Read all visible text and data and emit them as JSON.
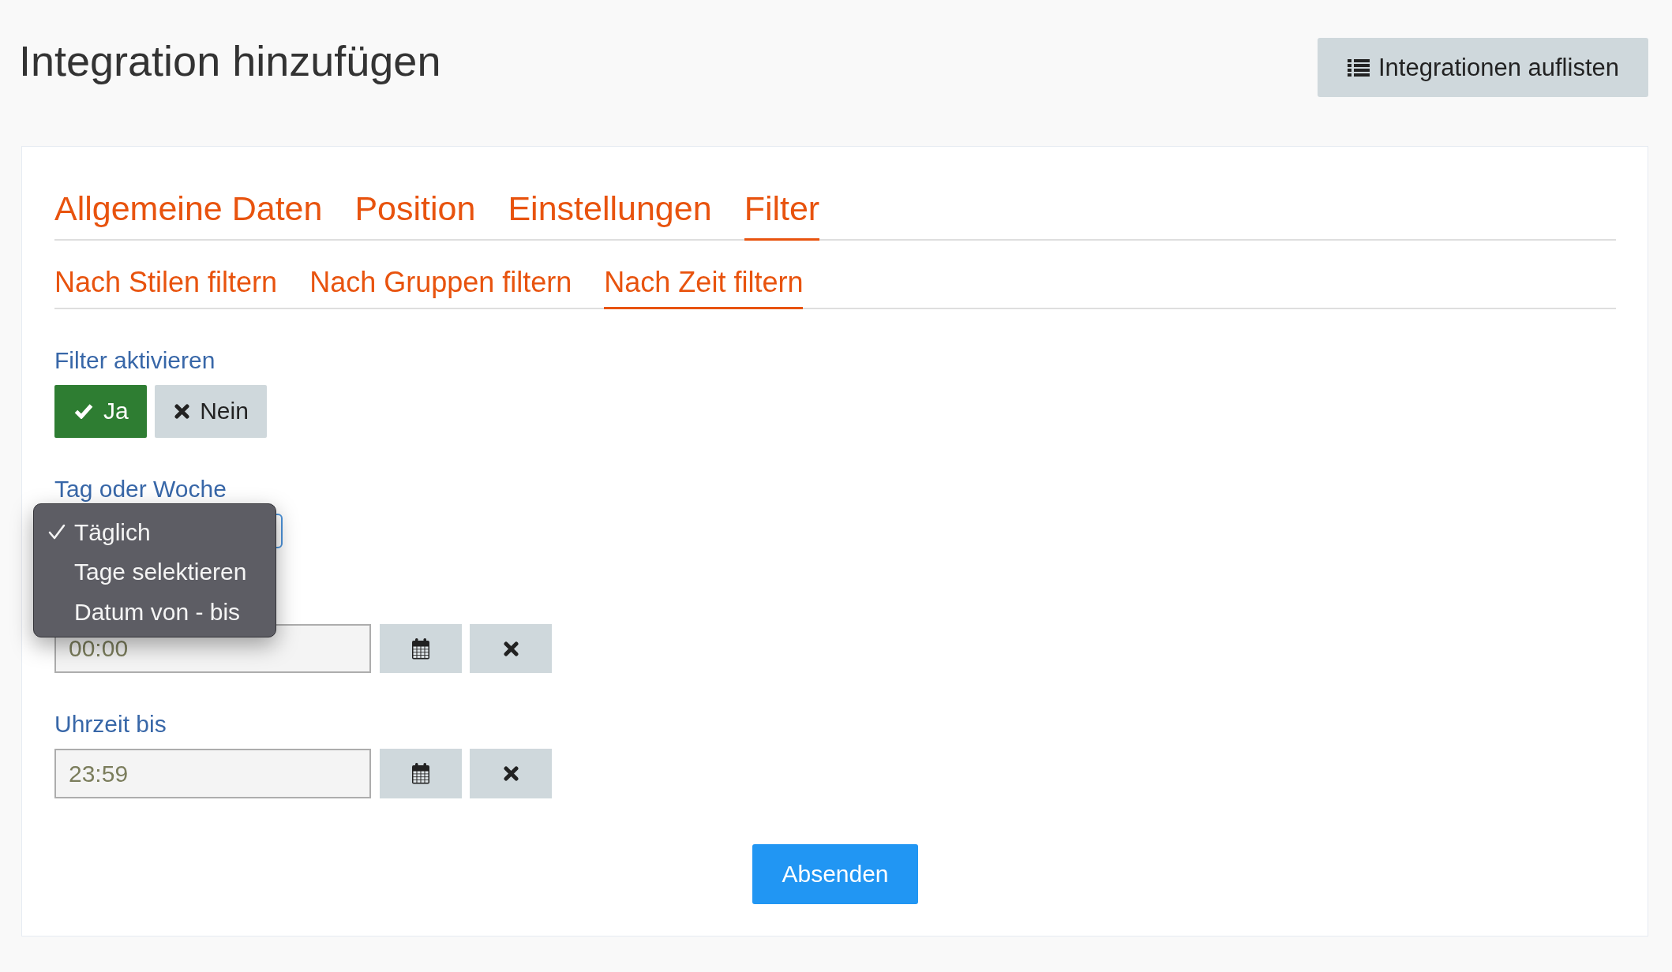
{
  "header": {
    "title": "Integration hinzufügen",
    "list_button": "Integrationen auflisten"
  },
  "tabs": [
    {
      "label": "Allgemeine Daten",
      "selected": false
    },
    {
      "label": "Position",
      "selected": false
    },
    {
      "label": "Einstellungen",
      "selected": false
    },
    {
      "label": "Filter",
      "selected": true
    }
  ],
  "subtabs": [
    {
      "label": "Nach Stilen filtern",
      "selected": false
    },
    {
      "label": "Nach Gruppen filtern",
      "selected": false
    },
    {
      "label": "Nach Zeit filtern",
      "selected": true
    }
  ],
  "filter_active": {
    "label": "Filter aktivieren",
    "options": [
      {
        "kind": "yes",
        "label": "Ja",
        "selected": true
      },
      {
        "kind": "no",
        "label": "Nein",
        "selected": false
      }
    ]
  },
  "day_or_week": {
    "label": "Tag oder Woche",
    "expanded": true,
    "options": [
      {
        "label": "Täglich",
        "selected": true
      },
      {
        "label": "Tage selektieren",
        "selected": false
      },
      {
        "label": "Datum von - bis",
        "selected": false
      }
    ]
  },
  "time_fields": [
    {
      "value": "00:00"
    },
    {
      "label": "Uhrzeit bis",
      "value": "23:59"
    }
  ],
  "submit_button": "Absenden"
}
